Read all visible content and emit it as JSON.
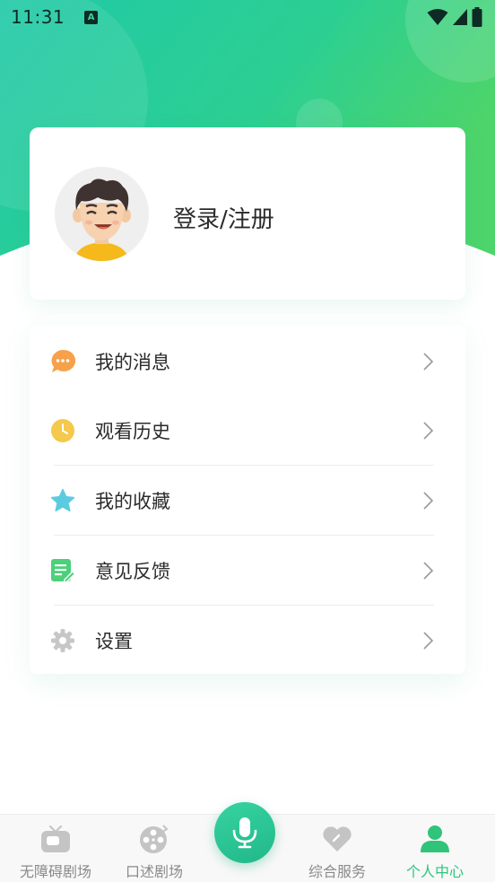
{
  "status_bar": {
    "time": "11:31",
    "notification_icon_letter": "A",
    "icons": [
      "wifi-icon",
      "signal-icon",
      "battery-icon"
    ]
  },
  "profile": {
    "login_label": "登录/注册",
    "avatar_icon": "cartoon-avatar"
  },
  "menu": {
    "items": [
      {
        "label": "我的消息",
        "icon": "message-bubble-icon",
        "color": "#f7a14b"
      },
      {
        "label": "观看历史",
        "icon": "clock-icon",
        "color": "#f4c94c"
      },
      {
        "label": "我的收藏",
        "icon": "star-icon",
        "color": "#5ccbe0"
      },
      {
        "label": "意见反馈",
        "icon": "feedback-note-icon",
        "color": "#4cd07a"
      },
      {
        "label": "设置",
        "icon": "gear-icon",
        "color": "#c7c7c7"
      }
    ]
  },
  "tabbar": {
    "tabs": [
      {
        "label": "无障碍剧场",
        "icon": "tv-icon",
        "active": false
      },
      {
        "label": "口述剧场",
        "icon": "film-reel-icon",
        "active": false
      },
      {
        "label": "综合服务",
        "icon": "heart-icon",
        "active": false
      },
      {
        "label": "个人中心",
        "icon": "person-icon",
        "active": true
      }
    ],
    "center_button_icon": "microphone-icon"
  },
  "colors": {
    "accent_green": "#2fc47a",
    "gradient_start": "#1cc6a4",
    "gradient_end": "#4dd46b",
    "inactive_tab": "#8a8a8a"
  }
}
